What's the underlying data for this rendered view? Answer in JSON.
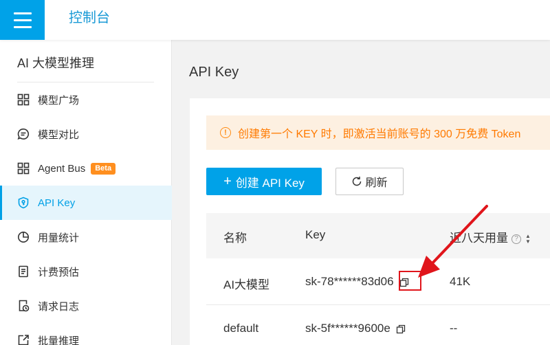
{
  "header": {
    "title": "控制台"
  },
  "sidebar": {
    "heading": "AI 大模型推理",
    "items": [
      {
        "label": "模型广场",
        "icon": "grid-icon"
      },
      {
        "label": "模型对比",
        "icon": "chat-icon"
      },
      {
        "label": "Agent Bus",
        "icon": "grid-icon",
        "badge": "Beta"
      },
      {
        "label": "API Key",
        "icon": "shield-key-icon",
        "active": true
      },
      {
        "label": "用量统计",
        "icon": "pie-chart-icon"
      },
      {
        "label": "计费预估",
        "icon": "document-icon"
      },
      {
        "label": "请求日志",
        "icon": "log-clock-icon"
      },
      {
        "label": "批量推理",
        "icon": "export-icon"
      }
    ]
  },
  "main": {
    "title": "API Key",
    "notice": "创建第一个 KEY 时，即激活当前账号的 300 万免费 Token",
    "create_button": "创建 API Key",
    "refresh_button": "刷新",
    "table": {
      "columns": [
        "名称",
        "Key",
        "近八天用量"
      ],
      "rows": [
        {
          "name": "AI大模型",
          "key": "sk-78******83d06",
          "usage": "41K"
        },
        {
          "name": "default",
          "key": "sk-5f******9600e",
          "usage": "--"
        }
      ]
    }
  },
  "colors": {
    "primary": "#00a2e8",
    "warning": "#ff7a00",
    "annotation": "#e0151b"
  }
}
